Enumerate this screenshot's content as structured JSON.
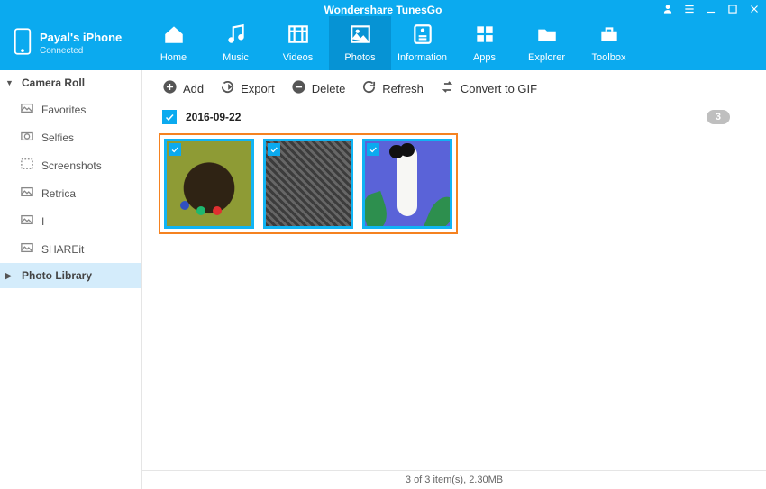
{
  "app": {
    "title": "Wondershare TunesGo"
  },
  "device": {
    "name": "Payal's iPhone",
    "status": "Connected"
  },
  "nav": {
    "items": [
      {
        "label": "Home",
        "icon": "home-icon",
        "active": false
      },
      {
        "label": "Music",
        "icon": "music-icon",
        "active": false
      },
      {
        "label": "Videos",
        "icon": "videos-icon",
        "active": false
      },
      {
        "label": "Photos",
        "icon": "photos-icon",
        "active": true
      },
      {
        "label": "Information",
        "icon": "information-icon",
        "active": false
      },
      {
        "label": "Apps",
        "icon": "apps-icon",
        "active": false
      },
      {
        "label": "Explorer",
        "icon": "explorer-icon",
        "active": false
      },
      {
        "label": "Toolbox",
        "icon": "toolbox-icon",
        "active": false
      }
    ]
  },
  "sidebar": {
    "sections": [
      {
        "label": "Camera Roll",
        "type": "heading",
        "expanded": true
      },
      {
        "label": "Favorites",
        "type": "sub",
        "icon": "photo-icon"
      },
      {
        "label": "Selfies",
        "type": "sub",
        "icon": "camera-icon"
      },
      {
        "label": "Screenshots",
        "type": "sub",
        "icon": "screenshot-icon"
      },
      {
        "label": "Retrica",
        "type": "sub",
        "icon": "photo-icon"
      },
      {
        "label": "I",
        "type": "sub",
        "icon": "photo-icon"
      },
      {
        "label": "SHAREit",
        "type": "sub",
        "icon": "photo-icon"
      },
      {
        "label": "Photo Library",
        "type": "heading",
        "expanded": false,
        "selected": true
      }
    ]
  },
  "toolbar": {
    "add": "Add",
    "export": "Export",
    "delete": "Delete",
    "refresh": "Refresh",
    "gif": "Convert to GIF"
  },
  "group": {
    "date": "2016-09-22",
    "count": "3",
    "allChecked": true,
    "items": [
      {
        "checked": true
      },
      {
        "checked": true
      },
      {
        "checked": true
      }
    ]
  },
  "status": {
    "text": "3 of 3 item(s), 2.30MB"
  }
}
